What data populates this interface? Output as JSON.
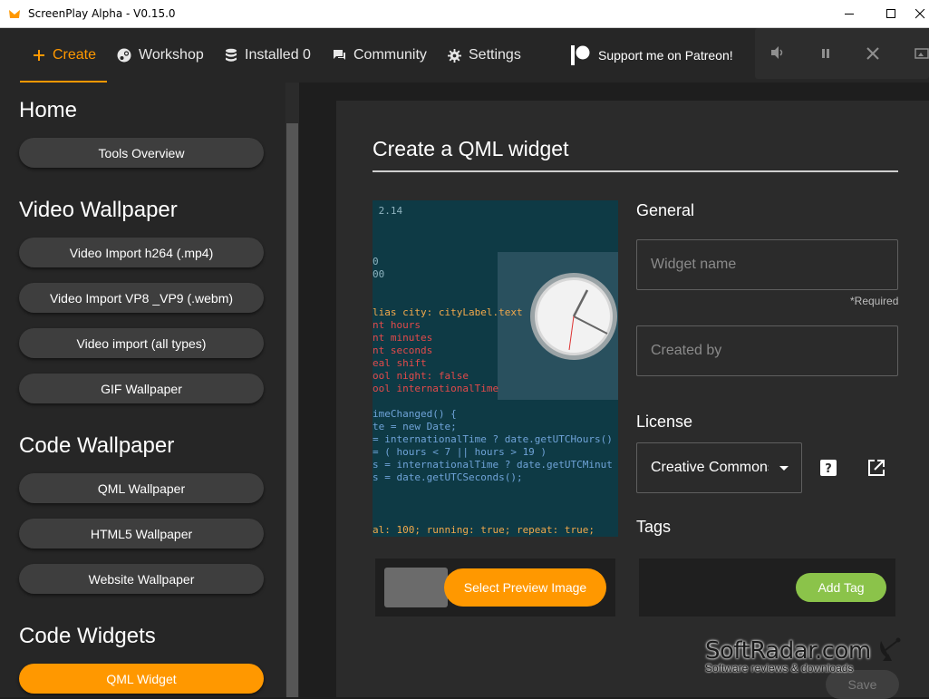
{
  "window": {
    "title": "ScreenPlay Alpha - V0.15.0",
    "minimize": "—",
    "maximize": "☐",
    "close": "✕"
  },
  "nav": {
    "items": [
      {
        "label": "Create",
        "icon": "plus-icon",
        "active": true
      },
      {
        "label": "Workshop",
        "icon": "steam-icon"
      },
      {
        "label": "Installed 0",
        "icon": "database-icon"
      },
      {
        "label": "Community",
        "icon": "chat-icon"
      },
      {
        "label": "Settings",
        "icon": "gear-icon"
      }
    ],
    "patreon": "Support me on Patreon!"
  },
  "player": {
    "icons": [
      "volume-icon",
      "pause-icon",
      "close-icon",
      "wallpaper-icon"
    ]
  },
  "sidebar": {
    "sections": [
      {
        "title": "Home",
        "buttons": [
          "Tools Overview"
        ]
      },
      {
        "title": "Video Wallpaper",
        "buttons": [
          "Video Import h264 (.mp4)",
          "Video Import VP8 _VP9 (.webm)",
          "Video import (all types)",
          "GIF Wallpaper"
        ]
      },
      {
        "title": "Code Wallpaper",
        "buttons": [
          "QML Wallpaper",
          "HTML5 Wallpaper",
          "Website Wallpaper"
        ]
      },
      {
        "title": "Code Widgets",
        "buttons": [
          "QML Widget"
        ]
      }
    ]
  },
  "form": {
    "title": "Create a QML widget",
    "general_label": "General",
    "widget_name_placeholder": "Widget name",
    "required_note": "*Required",
    "created_by_placeholder": "Created by",
    "license_label": "License",
    "license_value": "Creative Commons",
    "tags_label": "Tags",
    "select_preview": "Select Preview Image",
    "add_tag": "Add Tag",
    "save": "Save"
  },
  "preview_code": [
    {
      "text": " 2.14",
      "color": "#8fb3bf"
    },
    {
      "text": "0",
      "color": "#8fb3bf"
    },
    {
      "text": "00",
      "color": "#8fb3bf"
    },
    {
      "text": "lias city: cityLabel.text",
      "color": "#f1a84b"
    },
    {
      "text": "nt hours",
      "color": "#e34a4a"
    },
    {
      "text": "nt minutes",
      "color": "#e34a4a"
    },
    {
      "text": "nt seconds",
      "color": "#e34a4a"
    },
    {
      "text": "eal shift",
      "color": "#e34a4a"
    },
    {
      "text": "ool night: false",
      "color": "#e34a4a"
    },
    {
      "text": "ool internationalTime",
      "color": "#e34a4a"
    },
    {
      "text": "imeChanged() {",
      "color": "#6fa3d8"
    },
    {
      "text": "te = new Date;",
      "color": "#6fa3d8"
    },
    {
      "text": "= internationalTime ? date.getUTCHours()",
      "color": "#6fa3d8"
    },
    {
      "text": "= ( hours < 7 || hours > 19 )",
      "color": "#6fa3d8"
    },
    {
      "text": "s = internationalTime ? date.getUTCMinut",
      "color": "#6fa3d8"
    },
    {
      "text": "s = date.getUTCSeconds();",
      "color": "#6fa3d8"
    },
    {
      "text": "al: 100; running: true; repeat: true;",
      "color": "#f1a84b"
    }
  ],
  "watermark": {
    "main": "SoftRadar.com",
    "sub": "Software reviews & downloads"
  }
}
